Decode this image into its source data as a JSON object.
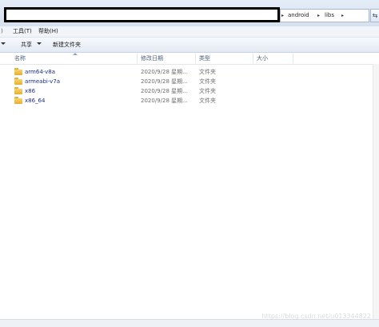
{
  "address_bar": {
    "breadcrumbs": [
      "android",
      "libs"
    ],
    "separator_glyph": "▸"
  },
  "menu": {
    "tools": "工具(T)",
    "help": "帮助(H)"
  },
  "commands": {
    "share": "共享",
    "new_folder": "新建文件夹"
  },
  "columns": {
    "name": "名称",
    "date_modified": "修改日期",
    "type": "类型",
    "size": "大小"
  },
  "files": [
    {
      "name": "arm64-v8a",
      "date": "2020/9/28 星期...",
      "type": "文件夹",
      "icon": "folder-icon"
    },
    {
      "name": "armeabi-v7a",
      "date": "2020/9/28 星期...",
      "type": "文件夹",
      "icon": "folder-icon"
    },
    {
      "name": "x86",
      "date": "2020/9/28 星期...",
      "type": "文件夹",
      "icon": "folder-icon"
    },
    {
      "name": "x86_64",
      "date": "2020/9/28 星期...",
      "type": "文件夹",
      "icon": "folder-icon"
    }
  ],
  "watermark": "https://blog.csdn.net/u013344822",
  "colors": {
    "folder_name": "#1c2f8a",
    "meta_text": "#6d6d6d",
    "folder_icon": "#e5ae2f",
    "toolbar_bg": "#e4ecf6"
  }
}
